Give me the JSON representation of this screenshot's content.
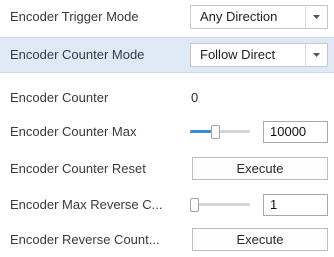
{
  "rows": [
    {
      "label": "Encoder Trigger Mode",
      "control": "combo",
      "value": "Any Direction"
    },
    {
      "label": "Encoder Counter Mode",
      "control": "combo",
      "value": "Follow Direct",
      "selected": true
    },
    {
      "label": "Encoder Counter",
      "control": "text",
      "value": "0"
    },
    {
      "label": "Encoder Counter Max",
      "control": "slider",
      "value": "10000",
      "slider_fraction": 0.4
    },
    {
      "label": "Encoder Counter Reset",
      "control": "button",
      "value": "Execute"
    },
    {
      "label": "Encoder Max Reverse C...",
      "control": "slider",
      "value": "1",
      "slider_fraction": 0.0
    },
    {
      "label": "Encoder Reverse Count...",
      "control": "button",
      "value": "Execute"
    }
  ],
  "colors": {
    "selected_row_bg": "#dfe9f6",
    "slider_fill": "#3c8be0"
  },
  "icons": {
    "dropdown": "chevron-down-icon"
  }
}
